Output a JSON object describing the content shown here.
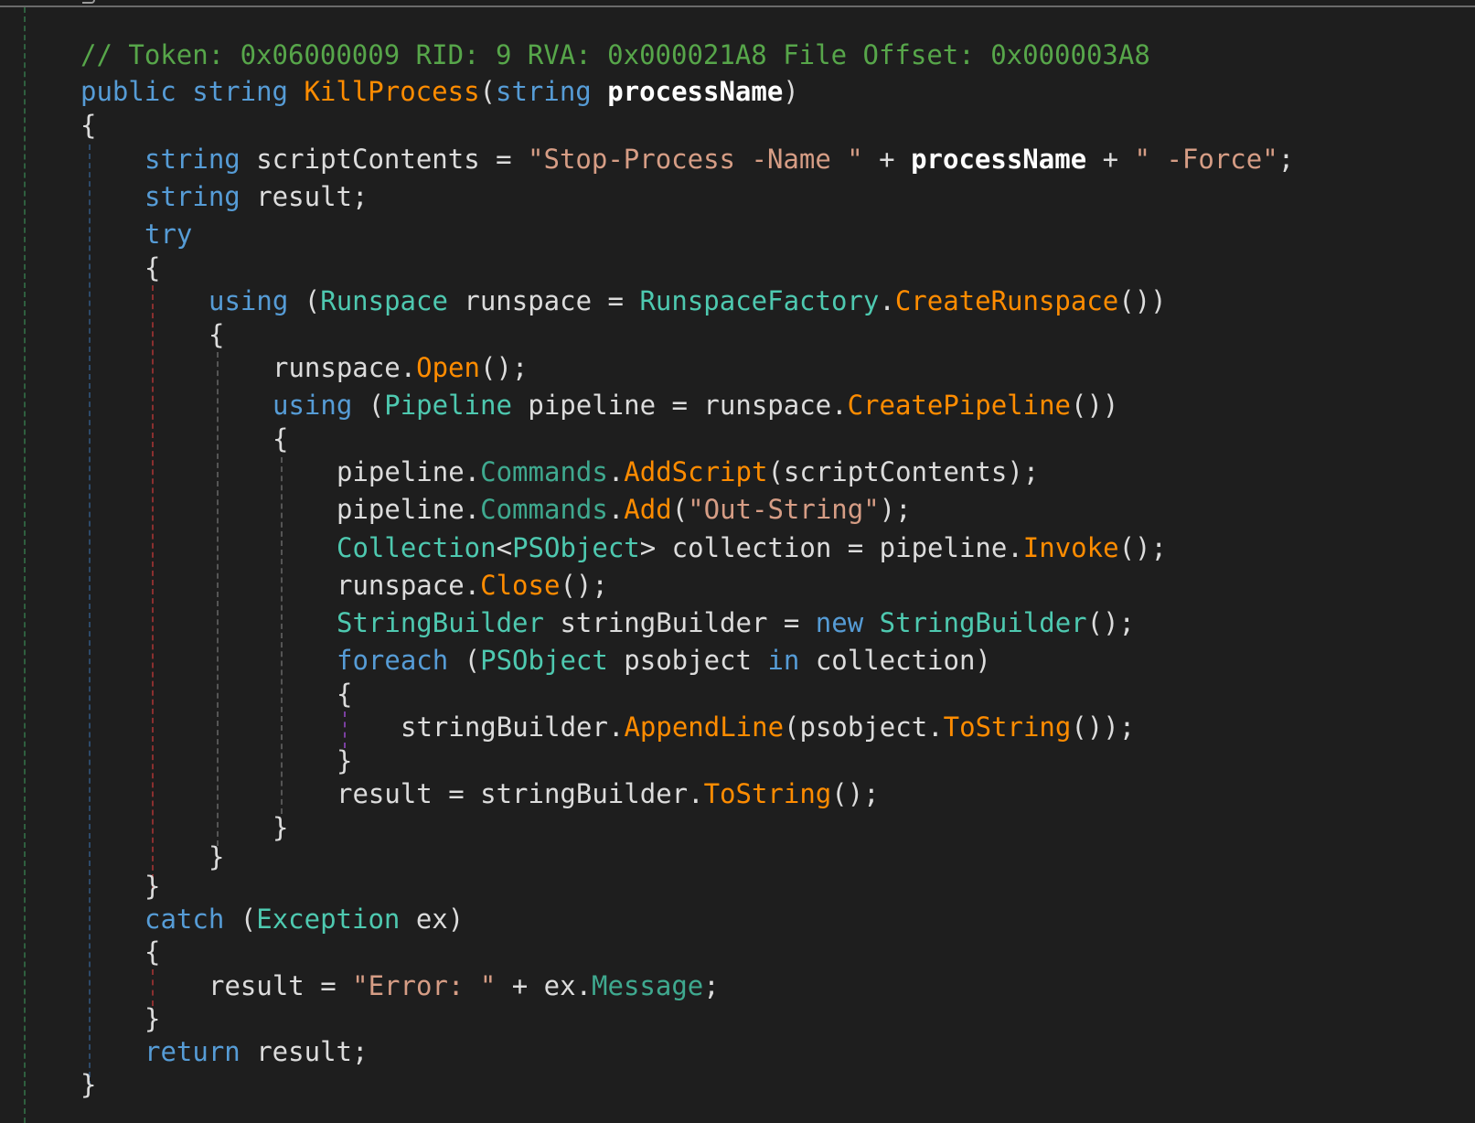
{
  "code_lines": [
    {
      "indent": 0,
      "tokens": [
        {
          "t": "// Token: 0x06000009 RID: 9 RVA: 0x000021A8 File Offset: 0x000003A8",
          "k": "comment"
        }
      ]
    },
    {
      "indent": 0,
      "tokens": [
        {
          "t": "public",
          "k": "kw"
        },
        {
          "t": " ",
          "k": "punct"
        },
        {
          "t": "string",
          "k": "kw"
        },
        {
          "t": " ",
          "k": "punct"
        },
        {
          "t": "KillProcess",
          "k": "method"
        },
        {
          "t": "(",
          "k": "punct"
        },
        {
          "t": "string",
          "k": "kw"
        },
        {
          "t": " ",
          "k": "punct"
        },
        {
          "t": "processName",
          "k": "param"
        },
        {
          "t": ")",
          "k": "punct"
        }
      ]
    },
    {
      "indent": 0,
      "tokens": [
        {
          "t": "{",
          "k": "punct"
        }
      ]
    },
    {
      "indent": 1,
      "tokens": [
        {
          "t": "string",
          "k": "kw"
        },
        {
          "t": " scriptContents = ",
          "k": "id"
        },
        {
          "t": "\"Stop-Process -Name \"",
          "k": "str"
        },
        {
          "t": " + ",
          "k": "punct"
        },
        {
          "t": "processName",
          "k": "param"
        },
        {
          "t": " + ",
          "k": "punct"
        },
        {
          "t": "\" -Force\"",
          "k": "str"
        },
        {
          "t": ";",
          "k": "punct"
        }
      ]
    },
    {
      "indent": 1,
      "tokens": [
        {
          "t": "string",
          "k": "kw"
        },
        {
          "t": " result;",
          "k": "id"
        }
      ]
    },
    {
      "indent": 1,
      "tokens": [
        {
          "t": "try",
          "k": "kw"
        }
      ]
    },
    {
      "indent": 1,
      "tokens": [
        {
          "t": "{",
          "k": "punct"
        }
      ]
    },
    {
      "indent": 2,
      "tokens": [
        {
          "t": "using",
          "k": "kw"
        },
        {
          "t": " (",
          "k": "punct"
        },
        {
          "t": "Runspace",
          "k": "type"
        },
        {
          "t": " runspace = ",
          "k": "id"
        },
        {
          "t": "RunspaceFactory",
          "k": "type"
        },
        {
          "t": ".",
          "k": "punct"
        },
        {
          "t": "CreateRunspace",
          "k": "method"
        },
        {
          "t": "())",
          "k": "punct"
        }
      ]
    },
    {
      "indent": 2,
      "tokens": [
        {
          "t": "{",
          "k": "punct"
        }
      ]
    },
    {
      "indent": 3,
      "tokens": [
        {
          "t": "runspace.",
          "k": "id"
        },
        {
          "t": "Open",
          "k": "method"
        },
        {
          "t": "();",
          "k": "punct"
        }
      ]
    },
    {
      "indent": 3,
      "tokens": [
        {
          "t": "using",
          "k": "kw"
        },
        {
          "t": " (",
          "k": "punct"
        },
        {
          "t": "Pipeline",
          "k": "type"
        },
        {
          "t": " pipeline = runspace.",
          "k": "id"
        },
        {
          "t": "CreatePipeline",
          "k": "method"
        },
        {
          "t": "())",
          "k": "punct"
        }
      ]
    },
    {
      "indent": 3,
      "tokens": [
        {
          "t": "{",
          "k": "punct"
        }
      ]
    },
    {
      "indent": 4,
      "tokens": [
        {
          "t": "pipeline.",
          "k": "id"
        },
        {
          "t": "Commands",
          "k": "prop"
        },
        {
          "t": ".",
          "k": "punct"
        },
        {
          "t": "AddScript",
          "k": "method"
        },
        {
          "t": "(scriptContents);",
          "k": "id"
        }
      ]
    },
    {
      "indent": 4,
      "tokens": [
        {
          "t": "pipeline.",
          "k": "id"
        },
        {
          "t": "Commands",
          "k": "prop"
        },
        {
          "t": ".",
          "k": "punct"
        },
        {
          "t": "Add",
          "k": "method"
        },
        {
          "t": "(",
          "k": "punct"
        },
        {
          "t": "\"Out-String\"",
          "k": "str"
        },
        {
          "t": ");",
          "k": "punct"
        }
      ]
    },
    {
      "indent": 4,
      "tokens": [
        {
          "t": "Collection",
          "k": "type"
        },
        {
          "t": "<",
          "k": "punct"
        },
        {
          "t": "PSObject",
          "k": "type"
        },
        {
          "t": "> collection = pipeline.",
          "k": "id"
        },
        {
          "t": "Invoke",
          "k": "method"
        },
        {
          "t": "();",
          "k": "punct"
        }
      ]
    },
    {
      "indent": 4,
      "tokens": [
        {
          "t": "runspace.",
          "k": "id"
        },
        {
          "t": "Close",
          "k": "method"
        },
        {
          "t": "();",
          "k": "punct"
        }
      ]
    },
    {
      "indent": 4,
      "tokens": [
        {
          "t": "StringBuilder",
          "k": "type"
        },
        {
          "t": " stringBuilder = ",
          "k": "id"
        },
        {
          "t": "new",
          "k": "kw"
        },
        {
          "t": " ",
          "k": "punct"
        },
        {
          "t": "StringBuilder",
          "k": "type"
        },
        {
          "t": "();",
          "k": "punct"
        }
      ]
    },
    {
      "indent": 4,
      "tokens": [
        {
          "t": "foreach",
          "k": "kw"
        },
        {
          "t": " (",
          "k": "punct"
        },
        {
          "t": "PSObject",
          "k": "type"
        },
        {
          "t": " psobject ",
          "k": "id"
        },
        {
          "t": "in",
          "k": "kw"
        },
        {
          "t": " collection)",
          "k": "id"
        }
      ]
    },
    {
      "indent": 4,
      "tokens": [
        {
          "t": "{",
          "k": "punct"
        }
      ]
    },
    {
      "indent": 5,
      "tokens": [
        {
          "t": "stringBuilder.",
          "k": "id"
        },
        {
          "t": "AppendLine",
          "k": "method"
        },
        {
          "t": "(psobject.",
          "k": "id"
        },
        {
          "t": "ToString",
          "k": "method"
        },
        {
          "t": "());",
          "k": "punct"
        }
      ]
    },
    {
      "indent": 4,
      "tokens": [
        {
          "t": "}",
          "k": "punct"
        }
      ]
    },
    {
      "indent": 4,
      "tokens": [
        {
          "t": "result = stringBuilder.",
          "k": "id"
        },
        {
          "t": "ToString",
          "k": "method"
        },
        {
          "t": "();",
          "k": "punct"
        }
      ]
    },
    {
      "indent": 3,
      "tokens": [
        {
          "t": "}",
          "k": "punct"
        }
      ]
    },
    {
      "indent": 2,
      "tokens": [
        {
          "t": "}",
          "k": "punct"
        }
      ]
    },
    {
      "indent": 1,
      "tokens": [
        {
          "t": "}",
          "k": "punct"
        }
      ]
    },
    {
      "indent": 1,
      "tokens": [
        {
          "t": "catch",
          "k": "kw"
        },
        {
          "t": " (",
          "k": "punct"
        },
        {
          "t": "Exception",
          "k": "type"
        },
        {
          "t": " ex)",
          "k": "id"
        }
      ]
    },
    {
      "indent": 1,
      "tokens": [
        {
          "t": "{",
          "k": "punct"
        }
      ]
    },
    {
      "indent": 2,
      "tokens": [
        {
          "t": "result = ",
          "k": "id"
        },
        {
          "t": "\"Error: \"",
          "k": "str"
        },
        {
          "t": " + ex.",
          "k": "id"
        },
        {
          "t": "Message",
          "k": "prop"
        },
        {
          "t": ";",
          "k": "punct"
        }
      ]
    },
    {
      "indent": 1,
      "tokens": [
        {
          "t": "}",
          "k": "punct"
        }
      ]
    },
    {
      "indent": 1,
      "tokens": [
        {
          "t": "return",
          "k": "kw"
        },
        {
          "t": " result;",
          "k": "id"
        }
      ]
    },
    {
      "indent": 0,
      "tokens": [
        {
          "t": "}",
          "k": "punct"
        }
      ]
    }
  ],
  "colors": {
    "background": "#1e1e1e",
    "comment": "#57a64a",
    "keyword": "#569cd6",
    "type": "#4ec9b0",
    "method": "#ff8c00",
    "string": "#d69d85",
    "identifier": "#dcdcdc"
  }
}
